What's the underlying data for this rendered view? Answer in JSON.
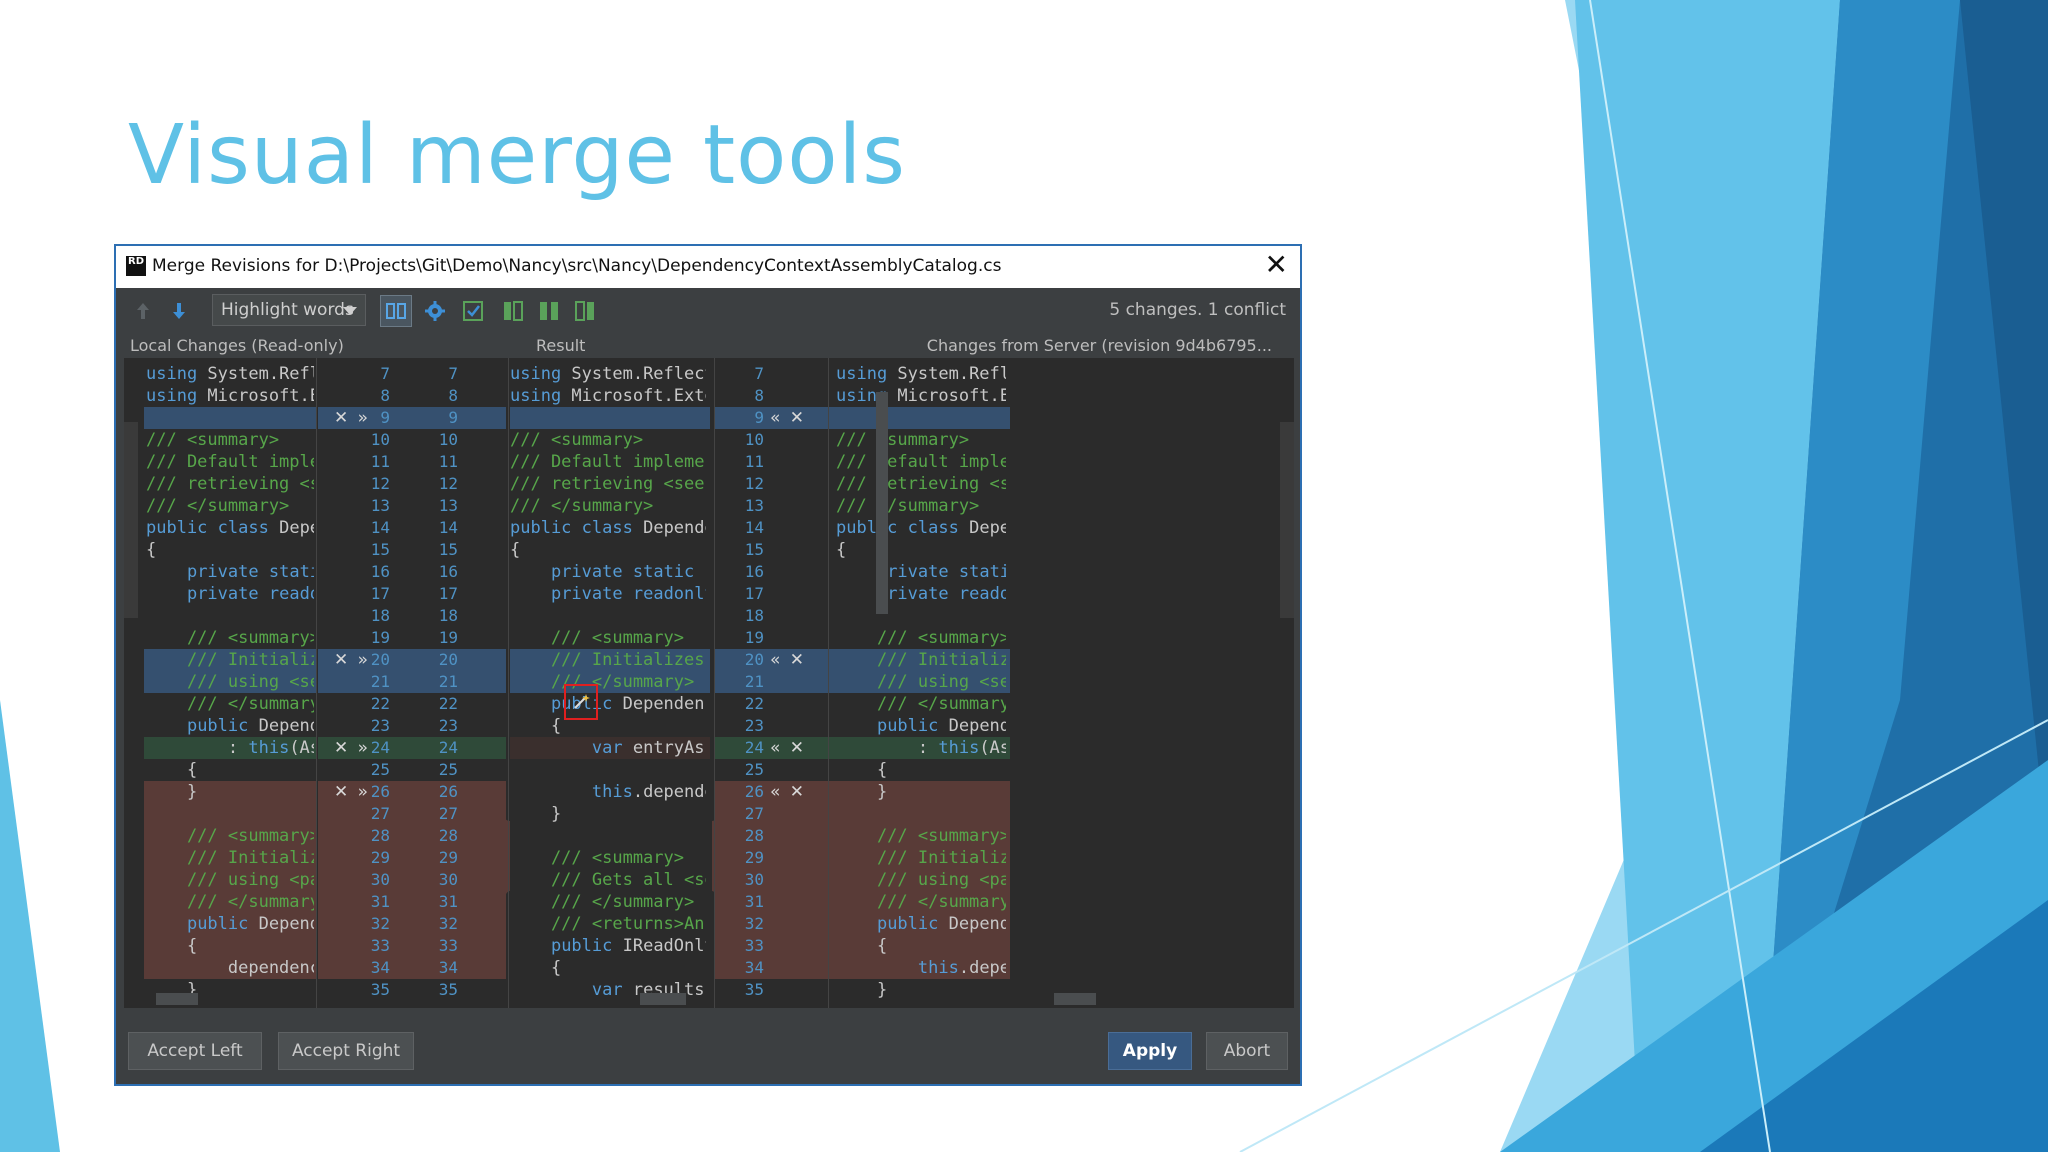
{
  "slide": {
    "title": "Visual merge tools"
  },
  "dialog": {
    "title": "Merge Revisions for D:\\Projects\\Git\\Demo\\Nancy\\src\\Nancy\\DependencyContextAssemblyCatalog.cs",
    "app_icon_text": "RD",
    "close_symbol": "✕"
  },
  "toolbar": {
    "highlight_mode": "Highlight words",
    "icons": [
      "prev-change-icon",
      "next-change-icon",
      "highlight-dropdown",
      "side-by-side-icon",
      "settings-gear-icon",
      "apply-non-conflicting-icon",
      "accept-left-icon",
      "accept-both-icon",
      "accept-right-icon"
    ],
    "changes_summary": "5 changes. 1 conflict"
  },
  "panes": {
    "left_header": "Local Changes (Read-only)",
    "center_header": "Result",
    "right_header": "Changes from Server (revision 9d4b6795..."
  },
  "editor": {
    "lines": [
      {
        "left": "using System.Reflecti",
        "ln_l": "7",
        "ln_cl": "7",
        "center": "using System.Reflection;",
        "ln_cr": "7",
        "right": "using System.Reflecti",
        "ln_r": "7"
      },
      {
        "left": "using Microsoft.Exter",
        "ln_l": "8",
        "ln_cl": "8",
        "center": "using Microsoft.Extensio",
        "ln_cr": "8",
        "right": "using Microsoft.Exter",
        "ln_r": "8"
      },
      {
        "left": "",
        "ln_l": "9",
        "ln_cl": "9",
        "center": "",
        "ln_cr": "9",
        "right": "",
        "ln_r": "",
        "marks_l": "✕ »",
        "marks_r": "« ✕"
      },
      {
        "left": "/// <summary>",
        "ln_l": "10",
        "ln_cl": "10",
        "center": "/// <summary>",
        "ln_cr": "10",
        "right": "/// <summary>",
        "ln_r": ""
      },
      {
        "left": "/// Default implement",
        "ln_l": "11",
        "ln_cl": "11",
        "center": "/// Default implementati",
        "ln_cr": "11",
        "right": "/// Default implement",
        "ln_r": ""
      },
      {
        "left": "/// retrieving <see c",
        "ln_l": "12",
        "ln_cl": "12",
        "center": "/// retrieving <see cref",
        "ln_cr": "12",
        "right": "/// retrieving <see c",
        "ln_r": ""
      },
      {
        "left": "/// </summary>",
        "ln_l": "13",
        "ln_cl": "13",
        "center": "/// </summary>",
        "ln_cr": "13",
        "right": "/// </summary>",
        "ln_r": ""
      },
      {
        "left": "public class Depender",
        "ln_l": "14",
        "ln_cl": "14",
        "center": "public class DependencyC",
        "ln_cr": "14",
        "right": "public class Depender",
        "ln_r": ""
      },
      {
        "left": "{",
        "ln_l": "15",
        "ln_cl": "15",
        "center": "{",
        "ln_cr": "15",
        "right": "{",
        "ln_r": ""
      },
      {
        "left": "    private static re",
        "ln_l": "16",
        "ln_cl": "16",
        "center": "    private static reado",
        "ln_cr": "16",
        "right": "    private static re",
        "ln_r": ""
      },
      {
        "left": "    private readonly ",
        "ln_l": "17",
        "ln_cl": "17",
        "center": "    private readonly Dep",
        "ln_cr": "17",
        "right": "    private readonly ",
        "ln_r": ""
      },
      {
        "left": "",
        "ln_l": "18",
        "ln_cl": "18",
        "center": "",
        "ln_cr": "18",
        "right": "",
        "ln_r": ""
      },
      {
        "left": "    /// <summary>",
        "ln_l": "19",
        "ln_cl": "19",
        "center": "    /// <summary>",
        "ln_cr": "19",
        "right": "    /// <summary>",
        "ln_r": ""
      },
      {
        "left": "    /// Initializes a",
        "ln_l": "20",
        "ln_cl": "20",
        "center": "    /// Initializes a new",
        "ln_cr": "20",
        "right": "    /// Initializes a",
        "ln_r": "",
        "marks_l": "✕ »",
        "marks_r": "« ✕"
      },
      {
        "left": "    /// using <see ci",
        "ln_l": "21",
        "ln_cl": "21",
        "center": "    /// </summary>",
        "ln_cr": "21",
        "right": "    /// using <see ci",
        "ln_r": ""
      },
      {
        "left": "    /// </summary>",
        "ln_l": "22",
        "ln_cl": "22",
        "center": "    public DependencyCon",
        "ln_cr": "22",
        "right": "    /// </summary>",
        "ln_r": ""
      },
      {
        "left": "    public Dependency",
        "ln_l": "23",
        "ln_cl": "23",
        "center": "    {",
        "ln_cr": "23",
        "right": "    public Dependency",
        "ln_r": ""
      },
      {
        "left": "        : this(Assemt",
        "ln_l": "24",
        "ln_cl": "24",
        "center": "        var entryAssembly",
        "ln_cr": "24",
        "right": "        : this(Assemt",
        "ln_r": "",
        "marks_l": "✕ »",
        "marks_r": "« ✕"
      },
      {
        "left": "    {",
        "ln_l": "25",
        "ln_cl": "25",
        "center": "",
        "ln_cr": "25",
        "right": "    {",
        "ln_r": ""
      },
      {
        "left": "    }",
        "ln_l": "26",
        "ln_cl": "26",
        "center": "        this.dependencyCo",
        "ln_cr": "26",
        "right": "    }",
        "ln_r": "",
        "marks_l": "✕ »",
        "marks_r": "« ✕"
      },
      {
        "left": "",
        "ln_l": "27",
        "ln_cl": "27",
        "center": "    }",
        "ln_cr": "27",
        "right": "",
        "ln_r": ""
      },
      {
        "left": "    /// <summary>",
        "ln_l": "28",
        "ln_cl": "28",
        "center": "",
        "ln_cr": "28",
        "right": "    /// <summary>",
        "ln_r": ""
      },
      {
        "left": "    /// Initializes a",
        "ln_l": "29",
        "ln_cl": "29",
        "center": "    /// <summary>",
        "ln_cr": "29",
        "right": "    /// Initializes a",
        "ln_r": ""
      },
      {
        "left": "    /// using <parami",
        "ln_l": "30",
        "ln_cl": "30",
        "center": "    /// Gets all <see cr",
        "ln_cr": "30",
        "right": "    /// using <parami",
        "ln_r": ""
      },
      {
        "left": "    /// </summary>",
        "ln_l": "31",
        "ln_cl": "31",
        "center": "    /// </summary>",
        "ln_cr": "31",
        "right": "    /// </summary>",
        "ln_r": ""
      },
      {
        "left": "    public Dependency",
        "ln_l": "32",
        "ln_cl": "32",
        "center": "    /// <returns>An <see",
        "ln_cr": "32",
        "right": "    public Dependency",
        "ln_r": ""
      },
      {
        "left": "    {",
        "ln_l": "33",
        "ln_cl": "33",
        "center": "    public IReadOnlyColl",
        "ln_cr": "33",
        "right": "    {",
        "ln_r": ""
      },
      {
        "left": "        dependencyCor",
        "ln_l": "34",
        "ln_cl": "34",
        "center": "    {",
        "ln_cr": "34",
        "right": "        this.depender",
        "ln_r": ""
      },
      {
        "left": "    }",
        "ln_l": "35",
        "ln_cl": "35",
        "center": "        var results = nei",
        "ln_cr": "35",
        "right": "    }",
        "ln_r": ""
      }
    ]
  },
  "buttons": {
    "accept_left": "Accept Left",
    "accept_right": "Accept Right",
    "apply": "Apply",
    "abort": "Abort"
  },
  "colors": {
    "accent": "#5fc1e6",
    "panel_bg": "#2b2b2b",
    "changed_bg": "#35506f",
    "conflict_bg": "#593b37",
    "modified_bg": "#2f4a39"
  }
}
